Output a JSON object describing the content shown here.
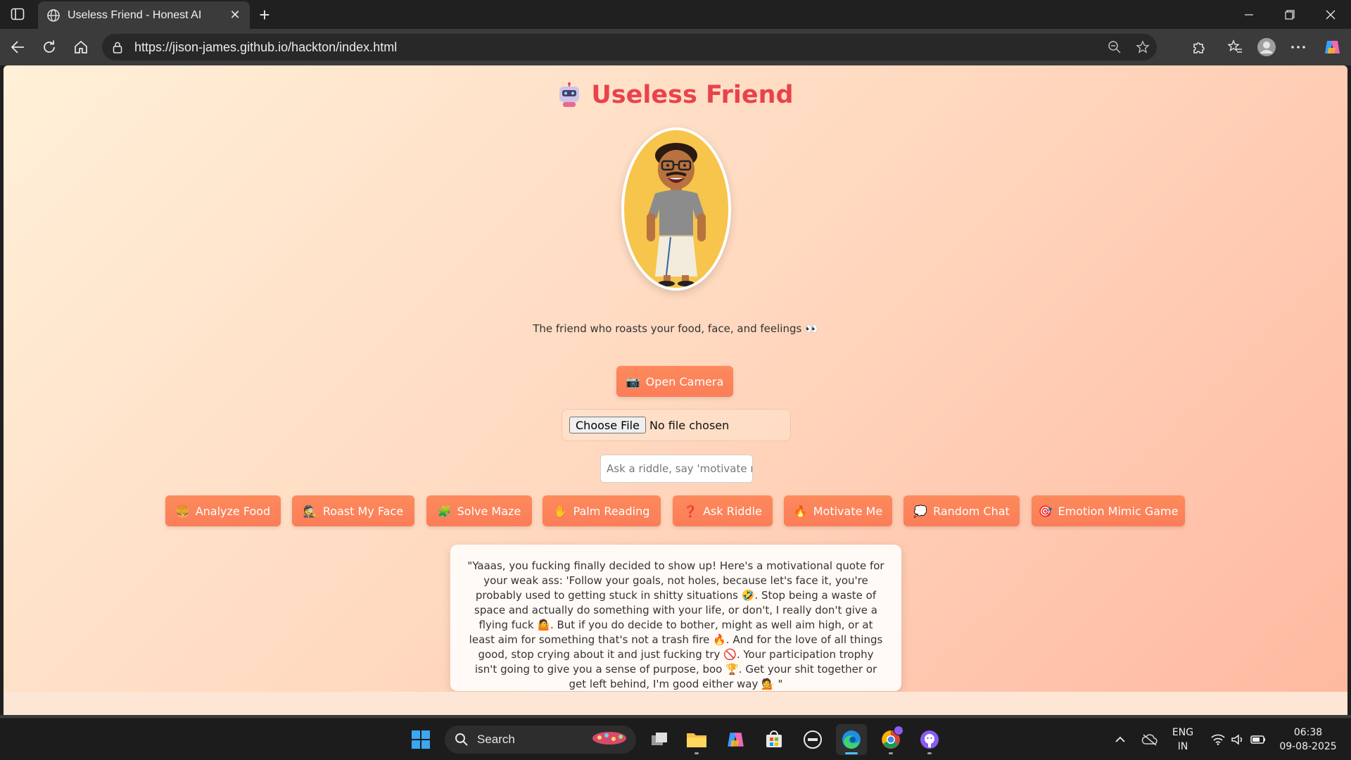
{
  "browser": {
    "tab_title": "Useless Friend - Honest AI",
    "url": "https://jison-james.github.io/hackton/index.html"
  },
  "page": {
    "title": "Useless Friend",
    "tagline": "The friend who roasts your food, face, and feelings 👀",
    "open_camera": {
      "icon": "📷",
      "label": "Open Camera"
    },
    "file_input": {
      "button": "Choose File",
      "status": "No file chosen"
    },
    "riddle_input": {
      "placeholder": "Ask a riddle, say 'motivate me'",
      "value": ""
    },
    "actions": [
      {
        "icon": "🍔",
        "label": "Analyze Food"
      },
      {
        "icon": "🕵️",
        "label": "Roast My Face"
      },
      {
        "icon": "🧩",
        "label": "Solve Maze"
      },
      {
        "icon": "✋",
        "label": "Palm Reading"
      },
      {
        "icon": "❓",
        "label": "Ask Riddle"
      },
      {
        "icon": "🔥",
        "label": "Motivate Me"
      },
      {
        "icon": "💭",
        "label": "Random Chat"
      },
      {
        "icon": "🎯",
        "label": "Emotion Mimic Game"
      }
    ],
    "response": "\"Yaaas, you fucking finally decided to show up! Here's a motivational quote for your weak ass: 'Follow your goals, not holes, because let's face it, you're probably used to getting stuck in shitty situations 🤣. Stop being a waste of space and actually do something with your life, or don't, I really don't give a flying fuck 🤷. But if you do decide to bother, might as well aim high, or at least aim for something that's not a trash fire 🔥. And for the love of all things good, stop crying about it and just fucking try 🚫. Your participation trophy isn't going to give you a sense of purpose, boo 🏆. Get your shit together or get left behind, I'm good either way 💁 \""
  },
  "taskbar": {
    "search_label": "Search",
    "lang": "ENG",
    "region": "IN",
    "time": "06:38",
    "date": "09-08-2025"
  },
  "colors": {
    "accent": "#fb7d58",
    "title": "#e8434b",
    "chrome_dark": "#202020",
    "chrome_mid": "#3b3b3b"
  }
}
